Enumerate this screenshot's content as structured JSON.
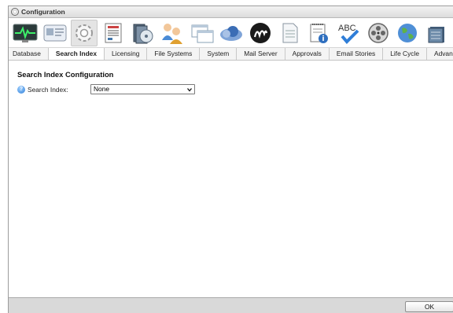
{
  "window": {
    "title": "Configuration"
  },
  "toolbar": {
    "icons": [
      "monitor-icon",
      "database-card-icon",
      "gear-icon",
      "file-list-icon",
      "filesystem-icon",
      "users-icon",
      "windows-icon",
      "cloud-icon",
      "mail-server-logo-icon",
      "document-icon",
      "notepad-info-icon",
      "spellcheck-icon",
      "film-reel-icon",
      "globe-icon",
      "stack-icon"
    ],
    "selected": "gear-icon"
  },
  "tabs": [
    {
      "label": "Database",
      "active": false
    },
    {
      "label": "Search Index",
      "active": true
    },
    {
      "label": "Licensing",
      "active": false
    },
    {
      "label": "File Systems",
      "active": false
    },
    {
      "label": "System",
      "active": false
    },
    {
      "label": "Mail Server",
      "active": false
    },
    {
      "label": "Approvals",
      "active": false
    },
    {
      "label": "Email Stories",
      "active": false
    },
    {
      "label": "Life Cycle",
      "active": false
    },
    {
      "label": "Advanced",
      "active": false
    }
  ],
  "main": {
    "section_title": "Search Index Configuration",
    "search_index": {
      "label": "Search Index:",
      "value": "None"
    }
  },
  "footer": {
    "ok_label": "OK"
  },
  "colors": {
    "accent": "#2f7ed8",
    "footer_bg": "#d9d9d9"
  }
}
